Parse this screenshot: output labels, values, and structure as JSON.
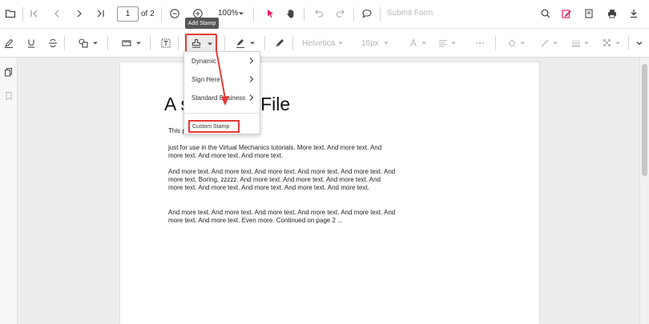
{
  "toolbar": {
    "page_number": "1",
    "page_total": "of 2",
    "zoom": "100%",
    "submit_form": "Submit Form"
  },
  "annotation_toolbar": {
    "font_family": "Helvetica",
    "font_size": "16px",
    "stamp_tooltip": "Add Stamp"
  },
  "stamp_menu": {
    "items": [
      "Dynamic",
      "Sign Here",
      "Standard Business"
    ],
    "custom": "Custom Stamp"
  },
  "document": {
    "title": "A s        DF File",
    "paragraphs": [
      "This                              pdf file -",
      "just for use in the Virtual Mechanics tutorials. More text. And more text. And more text. And more text. And more text.",
      "And more text. And more text. And more text. And more text. And more text. And more text. Boring, zzzzz. And more text. And more text. And more text. And more text. And more text. And more text. And more text. And more text.",
      "And more text. And more text. And more text. And more text. And more text. And more text. And more text. Even more. Continued on page 2 ..."
    ]
  },
  "colors": {
    "highlight": "#e53935",
    "accent": "#e91e63"
  }
}
